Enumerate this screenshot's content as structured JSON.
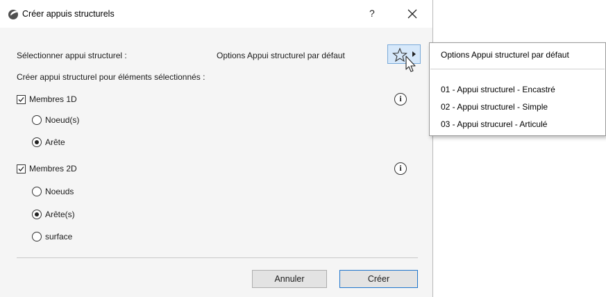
{
  "dialog": {
    "title": "Créer appuis structurels",
    "help_label": "?",
    "select_label": "Sélectionner appui structurel :",
    "select_value": "Options Appui structurel par défaut",
    "create_label": "Créer appui structurel pour éléments sélectionnés :",
    "group_1d": {
      "label": "Membres 1D",
      "checked": true,
      "options": [
        {
          "label": "Noeud(s)",
          "selected": false
        },
        {
          "label": "Arête",
          "selected": true
        }
      ]
    },
    "group_2d": {
      "label": "Membres 2D",
      "checked": true,
      "options": [
        {
          "label": "Noeuds",
          "selected": false
        },
        {
          "label": "Arête(s)",
          "selected": true
        },
        {
          "label": "surface",
          "selected": false
        }
      ]
    },
    "info_symbol": "i",
    "cancel_label": "Annuler",
    "create_button_label": "Créer"
  },
  "popup_menu": {
    "items": [
      {
        "label": "Options Appui structurel par défaut"
      },
      {
        "label": "01 - Appui structurel - Encastré"
      },
      {
        "label": "02 - Appui structurel - Simple"
      },
      {
        "label": "03 - Appui strucurel - Articulé"
      }
    ]
  },
  "colors": {
    "accent_border": "#1f75cc",
    "star_button_bg": "#d6e8fa",
    "dialog_bg": "#f5f5f5"
  },
  "icons": [
    "app-logo-icon",
    "close-icon",
    "star-icon",
    "submenu-arrow-icon",
    "mouse-cursor-icon",
    "info-icon",
    "checkmark-icon"
  ]
}
